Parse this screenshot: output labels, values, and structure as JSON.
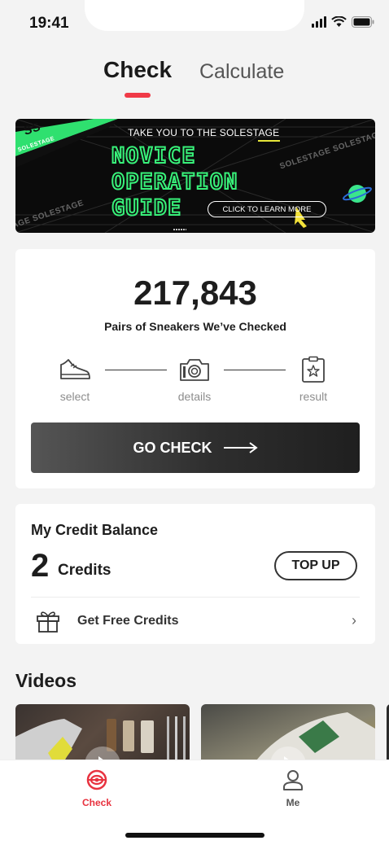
{
  "status_bar": {
    "time": "19:41"
  },
  "tabs": {
    "check": "Check",
    "calculate": "Calculate",
    "active": "Check",
    "accent": "#f03a47"
  },
  "banner": {
    "top_text": "TAKE YOU TO THE SOLESTAGE",
    "line1": "NOVICE",
    "line2": "OPERATION",
    "line3": "GUIDE",
    "cta": "CLICK TO LEARN MORE",
    "brand": "SOLESTAGE",
    "brand_short": "SS",
    "brand_bottom": "AGE  SOLESTAGE",
    "brand_top_right": "SOLESTAGE  SOLESTAG",
    "accent": "#38f27a"
  },
  "checked": {
    "count": "217,843",
    "subtitle": "Pairs of Sneakers We’ve Checked",
    "steps": [
      {
        "label": "select",
        "icon": "sneaker-icon"
      },
      {
        "label": "details",
        "icon": "camera-icon"
      },
      {
        "label": "result",
        "icon": "certificate-icon"
      }
    ],
    "button": "GO CHECK"
  },
  "credit": {
    "title": "My Credit Balance",
    "amount": "2",
    "unit": "Credits",
    "topup": "TOP UP",
    "free": "Get  Free Credits"
  },
  "videos": {
    "title": "Videos"
  },
  "tabbar": {
    "check": "Check",
    "me": "Me",
    "active_color": "#e8323f"
  }
}
